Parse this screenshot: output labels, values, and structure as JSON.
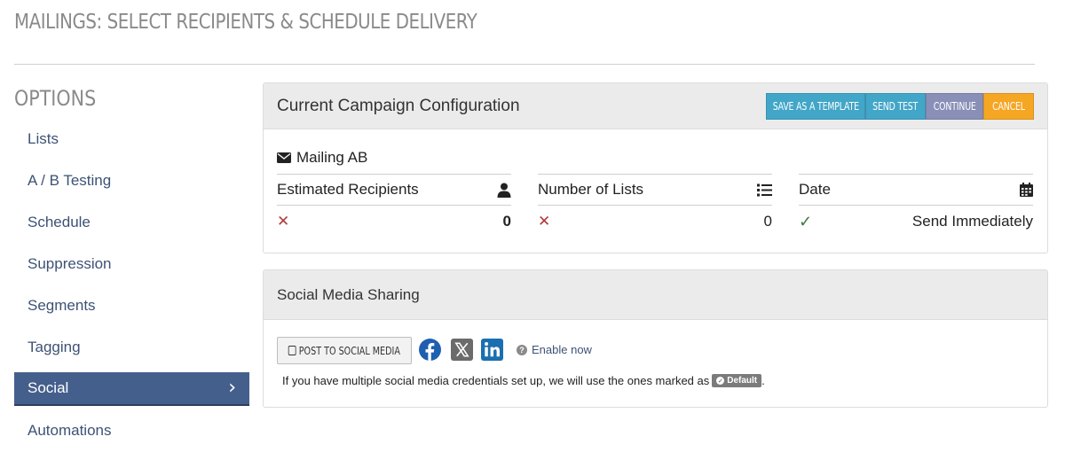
{
  "page": {
    "title": "MAILINGS: SELECT RECIPIENTS & SCHEDULE DELIVERY"
  },
  "sidebar": {
    "heading": "OPTIONS",
    "items": [
      {
        "label": "Lists"
      },
      {
        "label": "A / B Testing"
      },
      {
        "label": "Schedule"
      },
      {
        "label": "Suppression"
      },
      {
        "label": "Segments"
      },
      {
        "label": "Tagging"
      },
      {
        "label": "Social",
        "active": true
      },
      {
        "label": "Automations"
      }
    ]
  },
  "config": {
    "title": "Current Campaign Configuration",
    "buttons": {
      "save_template": "SAVE AS A TEMPLATE",
      "send_test": "SEND TEST",
      "continue": "CONTINUE",
      "cancel": "CANCEL"
    },
    "mailing_name": "Mailing AB",
    "stats": [
      {
        "label": "Estimated Recipients",
        "icon": "user-icon",
        "status": "x",
        "value": "0"
      },
      {
        "label": "Number of Lists",
        "icon": "list-icon",
        "status": "x",
        "value": "0"
      },
      {
        "label": "Date",
        "icon": "calendar-icon",
        "status": "check",
        "value": "Send Immediately"
      }
    ]
  },
  "social": {
    "title": "Social Media Sharing",
    "post_button": "POST TO SOCIAL MEDIA",
    "enable_now": "Enable now",
    "note": "If you have multiple social media credentials set up, we will use the ones marked as",
    "badge": "Default",
    "note_end": "."
  },
  "colors": {
    "active_nav": "#455f8c",
    "button_blue": "#42a6c8",
    "button_purple": "#8a8fb8",
    "button_orange": "#f5a623",
    "x_red": "#b03a3a",
    "check_green": "#3e7a3e"
  }
}
